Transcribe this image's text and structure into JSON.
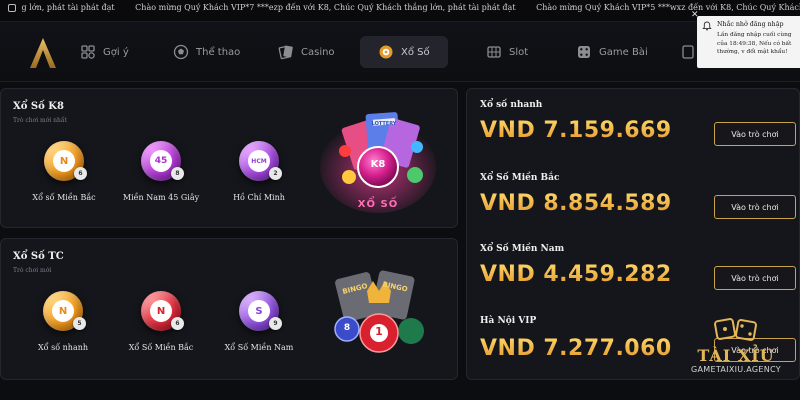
{
  "marquee": {
    "items": [
      "g lớn, phát tài phát đạt",
      "Chào mừng Quý Khách VIP*7 ***ezp đến với K8, Chúc Quý Khách thắng lớn, phát tài phát đạt",
      "Chào mừng Quý Khách VIP*5 ***wxz đến với K8, Chúc Quý Khách thắng lớn, phát tài phát đạt"
    ]
  },
  "nav": {
    "items": [
      {
        "label": "Gợi ý",
        "icon": "suggest-icon"
      },
      {
        "label": "Thể thao",
        "icon": "soccer-ball-icon"
      },
      {
        "label": "Casino",
        "icon": "cards-icon"
      },
      {
        "label": "Xổ Số",
        "icon": "lottery-icon",
        "active": true
      },
      {
        "label": "Slot",
        "icon": "slot-machine-icon"
      },
      {
        "label": "Game Bài",
        "icon": "dice-icon"
      }
    ]
  },
  "notification": {
    "close": "✕",
    "title": "Nhắc nhở đăng nhập",
    "body": "Lần đăng nhập cuối cùng của 18:49:38, Nếu có bất thường, v đổi mật khẩu!"
  },
  "k8_panel": {
    "title": "Xổ Số K8",
    "subtitle": "Trò chơi mới nhất",
    "games": [
      {
        "label": "Xổ số Miền Bắc",
        "ball_text": "N",
        "mini": "6"
      },
      {
        "label": "Miền Nam 45 Giây",
        "ball_text": "45",
        "mini": "8"
      },
      {
        "label": "Hồ Chí Minh",
        "ball_text": "HCM",
        "mini": "2"
      }
    ],
    "banner_label": "XỔ SỐ",
    "banner_ball": "K8",
    "banner_ticket": "LOTTERY"
  },
  "tc_panel": {
    "title": "Xổ Số TC",
    "subtitle": "Trò chơi mới",
    "games": [
      {
        "label": "Xổ số nhanh",
        "ball_text": "N",
        "mini": "5"
      },
      {
        "label": "Xổ Số Miền Bắc",
        "ball_text": "N",
        "mini": "6"
      },
      {
        "label": "Xổ Số Miền Nam",
        "ball_text": "S",
        "mini": "9"
      }
    ],
    "banner_card_1": "BINGO",
    "banner_card_2": "BINGO",
    "banner_ball": "1",
    "banner_ball_2": "8"
  },
  "jackpots": [
    {
      "name": "Xổ số nhanh",
      "amount": "VND 7.159.669",
      "button": "Vào trò chơi"
    },
    {
      "name": "Xổ Số Miền Bắc",
      "amount": "VND 8.854.589",
      "button": "Vào trò chơi"
    },
    {
      "name": "Xổ Số Miền Nam",
      "amount": "VND 4.459.282",
      "button": "Vào trò chơi"
    },
    {
      "name": "Hà Nội VIP",
      "amount": "VND 7.277.060",
      "button": "Vào trò chơi"
    }
  ],
  "watermark": {
    "title": "TÀI XỈU",
    "subtitle": "GAMETAIXIU.AGENCY"
  },
  "colors": {
    "accent_gold": "#f2b838",
    "background": "#0c0d10",
    "panel": "#15161b"
  }
}
